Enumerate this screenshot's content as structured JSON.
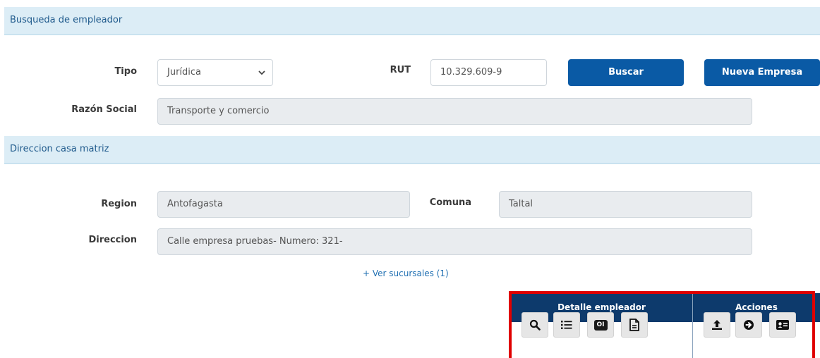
{
  "employer_search": {
    "section_title": "Busqueda de empleador",
    "tipo_label": "Tipo",
    "tipo_value": "Jurídica",
    "rut_label": "RUT",
    "rut_value": "10.329.609-9",
    "search_button": "Buscar",
    "new_company_button": "Nueva Empresa",
    "razon_social_label": "Razón Social",
    "razon_social_value": "Transporte y comercio"
  },
  "headquarters_address": {
    "section_title": "Direccion casa matriz",
    "region_label": "Region",
    "region_value": "Antofagasta",
    "comuna_label": "Comuna",
    "comuna_value": "Taltal",
    "direccion_label": "Direccion",
    "direccion_value": "Calle empresa pruebas- Numero: 321-",
    "branches_link": "+ Ver sucursales (1)"
  },
  "results_table": {
    "col_detail": "Detalle empleador",
    "col_actions": "Acciones",
    "detail_icons": [
      "search-icon",
      "list-icon",
      "oi-badge-icon",
      "document-icon"
    ],
    "action_icons": [
      "upload-icon",
      "arrow-right-circle-icon",
      "id-card-icon"
    ],
    "oi_badge_text": "OI"
  },
  "colors": {
    "section_bg": "#dcedf6",
    "primary_button": "#0a5aa5",
    "table_header": "#0d3a6c",
    "highlight": "#e00000"
  }
}
